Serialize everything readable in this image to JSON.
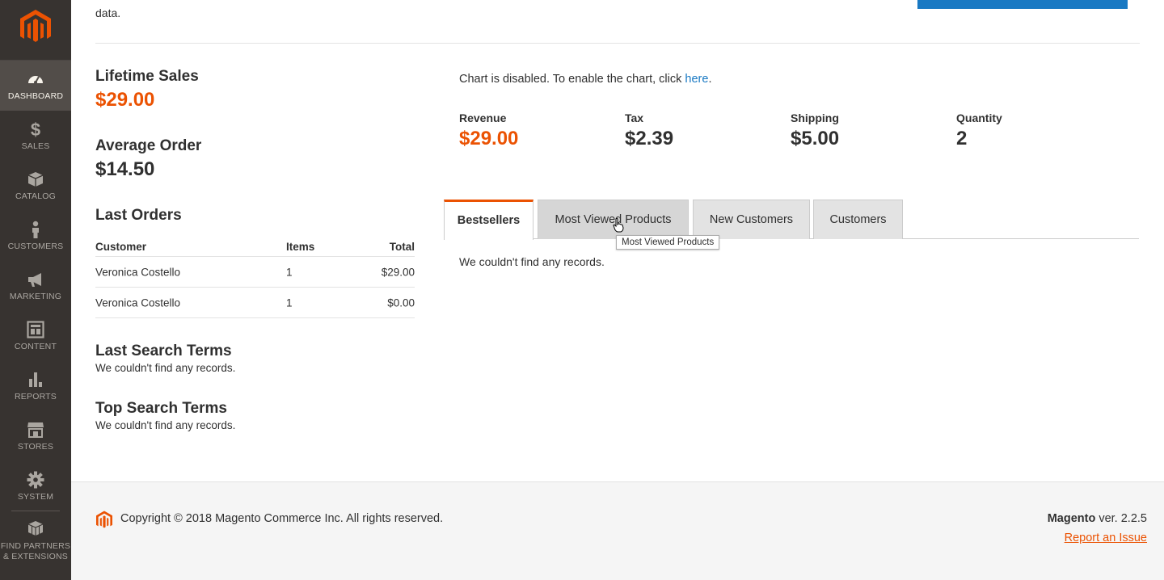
{
  "colors": {
    "accent": "#eb5202",
    "link": "#1979c3",
    "sidebar_bg": "#373330",
    "sidebar_active": "#524d49"
  },
  "sidebar": {
    "logo_icon": "magento-logo",
    "items": [
      {
        "label": "DASHBOARD",
        "icon": "speedometer-icon",
        "active": true
      },
      {
        "label": "SALES",
        "icon": "dollar-icon"
      },
      {
        "label": "CATALOG",
        "icon": "box-icon"
      },
      {
        "label": "CUSTOMERS",
        "icon": "person-icon"
      },
      {
        "label": "MARKETING",
        "icon": "megaphone-icon"
      },
      {
        "label": "CONTENT",
        "icon": "layout-icon"
      },
      {
        "label": "REPORTS",
        "icon": "bar-chart-icon"
      },
      {
        "label": "STORES",
        "icon": "store-icon"
      },
      {
        "label": "SYSTEM",
        "icon": "gear-icon"
      }
    ],
    "partners_label_1": "FIND PARTNERS",
    "partners_label_2": "& EXTENSIONS"
  },
  "top_text": "data.",
  "lifetime_sales": {
    "title": "Lifetime Sales",
    "value": "$29.00"
  },
  "average_order": {
    "title": "Average Order",
    "value": "$14.50"
  },
  "last_orders": {
    "title": "Last Orders",
    "headers": {
      "customer": "Customer",
      "items": "Items",
      "total": "Total"
    },
    "rows": [
      {
        "customer": "Veronica Costello",
        "items": "1",
        "total": "$29.00"
      },
      {
        "customer": "Veronica Costello",
        "items": "1",
        "total": "$0.00"
      }
    ]
  },
  "last_search": {
    "title": "Last Search Terms",
    "empty": "We couldn't find any records."
  },
  "top_search": {
    "title": "Top Search Terms",
    "empty": "We couldn't find any records."
  },
  "chart_message": {
    "text": "Chart is disabled. To enable the chart, click ",
    "link": "here",
    "suffix": "."
  },
  "metrics": [
    {
      "label": "Revenue",
      "value": "$29.00"
    },
    {
      "label": "Tax",
      "value": "$2.39"
    },
    {
      "label": "Shipping",
      "value": "$5.00"
    },
    {
      "label": "Quantity",
      "value": "2"
    }
  ],
  "tabs": [
    {
      "label": "Bestsellers",
      "active": true
    },
    {
      "label": "Most Viewed Products"
    },
    {
      "label": "New Customers"
    },
    {
      "label": "Customers"
    }
  ],
  "tooltip": "Most Viewed Products",
  "tab_content": "We couldn't find any records.",
  "footer": {
    "copyright": "Copyright © 2018 Magento Commerce Inc. All rights reserved.",
    "brand": "Magento",
    "version": " ver. 2.2.5",
    "report": "Report an Issue"
  }
}
